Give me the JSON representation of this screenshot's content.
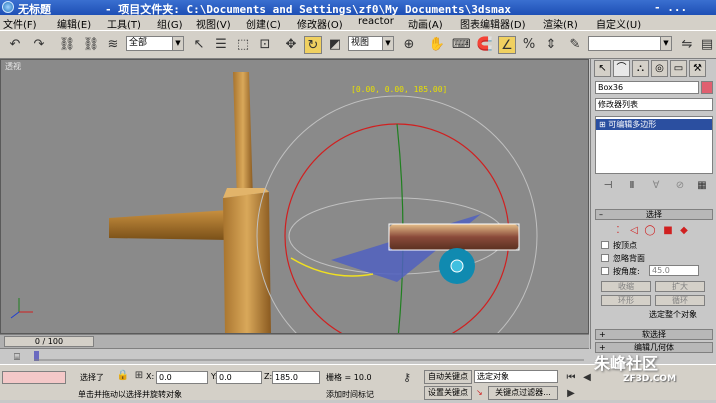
{
  "titlebar": {
    "title": "无标题",
    "project_path": "- 项目文件夹: C:\\Documents and Settings\\zf0\\My Documents\\3dsmax",
    "suffix": "- ..."
  },
  "menubar": {
    "items": [
      "文件(F)",
      "编辑(E)",
      "工具(T)",
      "组(G)",
      "视图(V)",
      "创建(C)",
      "修改器(O)",
      "reactor",
      "动画(A)",
      "图表编辑器(D)",
      "渲染(R)",
      "自定义(U)"
    ]
  },
  "toolbar": {
    "selection_filter": "全部",
    "ref_coord": "视图"
  },
  "viewport": {
    "label": "透视",
    "gizmo_coords": "[0.00, 0.00, 185.00]"
  },
  "command_panel": {
    "object_name": "Box36",
    "object_color": "#e06070",
    "modifier_list": "修改器列表",
    "stack_item": "可编辑多边形",
    "selection_rollout": "选择",
    "by_vertex": "按顶点",
    "ignore_backface": "忽略背面",
    "by_angle": "按角度:",
    "angle_value": "45.0",
    "shrink": "收缩",
    "grow": "扩大",
    "ring": "环形",
    "loop": "循环",
    "selected_info": "选定整个对象",
    "soft_selection": "软选择",
    "edit_geometry": "编辑几何体"
  },
  "timeline": {
    "frame_label": "0 / 100"
  },
  "status": {
    "selected_text": "选择了",
    "x_label": "X:",
    "x_value": "0.0",
    "y_label": "Y:",
    "y_value": "0.0",
    "z_label": "Z:",
    "z_value": "185.0",
    "grid": "栅格 = 10.0",
    "autokey": "自动关键点",
    "key_mode": "选定对象",
    "prompt": "单击并拖动以选择并旋转对象",
    "add_time_tag": "添加时间标记",
    "set_key": "设置关键点",
    "key_filters": "关键点过滤器..."
  },
  "watermark": {
    "main": "朱峰社区",
    "sub": "ZF3D.COM"
  },
  "colors": {
    "viewport_bg": "#8a8a8a",
    "accent": "#2b4fa0"
  }
}
